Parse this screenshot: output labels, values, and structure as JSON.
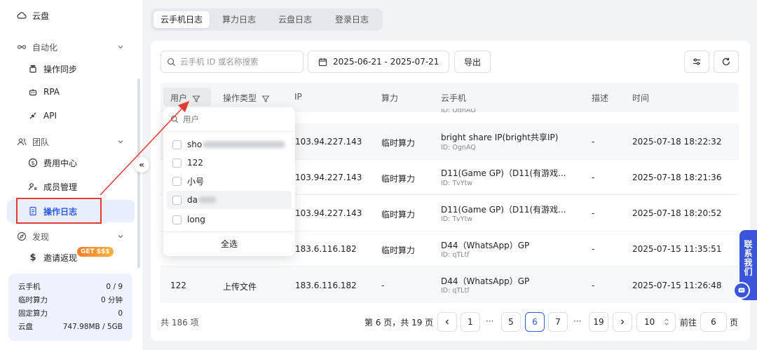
{
  "sidebar": {
    "cloud_disk": "云盘",
    "automation": "自动化",
    "sync": "操作同步",
    "rpa": "RPA",
    "api": "API",
    "team": "团队",
    "billing": "费用中心",
    "members": "成员管理",
    "logs": "操作日志",
    "discover": "发现",
    "invite": "邀请返现",
    "badge": "GET $$$"
  },
  "usage": [
    {
      "label": "云手机",
      "value": "0 / 9"
    },
    {
      "label": "临时算力",
      "value": "0 分钟"
    },
    {
      "label": "固定算力",
      "value": "0"
    },
    {
      "label": "云盘",
      "value": "747.98MB / 5GB"
    }
  ],
  "tabs": [
    "云手机日志",
    "算力日志",
    "云盘日志",
    "登录日志"
  ],
  "toolbar": {
    "search_placeholder": "云手机 ID 或名称搜索",
    "date_range": "2025-06-21 - 2025-07-21",
    "export": "导出"
  },
  "table": {
    "headers": [
      "用户",
      "操作类型",
      "IP",
      "算力",
      "云手机",
      "描述",
      "时间"
    ],
    "partial_id": "ID: OgnAQ",
    "rows": [
      {
        "ip": "103.94.227.143",
        "power": "临时算力",
        "phone": "bright share IP(bright共享IP)",
        "phone_id": "ID: OgnAQ",
        "desc": "-",
        "time": "2025-07-18 18:22:32"
      },
      {
        "ip": "103.94.227.143",
        "power": "临时算力",
        "phone": "D11(Game GP)（D11(有游戏...",
        "phone_id": "ID: TvYtw",
        "desc": "-",
        "time": "2025-07-18 18:21:36"
      },
      {
        "ip": "103.94.227.143",
        "power": "临时算力",
        "phone": "D11(Game GP)（D11(有游戏...",
        "phone_id": "ID: TvYtw",
        "desc": "-",
        "time": "2025-07-18 18:20:52"
      },
      {
        "ip": "183.6.116.182",
        "power": "临时算力",
        "phone": "D44（WhatsApp）GP",
        "phone_id": "ID: qTLtf",
        "desc": "-",
        "time": "2025-07-15 11:35:51"
      },
      {
        "user": "122",
        "op": "上传文件",
        "ip": "183.6.116.182",
        "power": "-",
        "phone": "D44（WhatsApp）GP",
        "phone_id": "ID: qTLtf",
        "desc": "-",
        "time": "2025-07-15 11:26:48"
      }
    ]
  },
  "dropdown": {
    "search_placeholder": "用户",
    "items": [
      "sho",
      "122",
      "小号",
      "da",
      "long"
    ],
    "select_all": "全选"
  },
  "pagination": {
    "total": "共 186 项",
    "page_info": "第 6 页，共 19 页",
    "pages": [
      "1",
      "5",
      "6",
      "7",
      "19"
    ],
    "dots": "···",
    "page_size": "10",
    "goto_label": "前往",
    "goto_value": "6",
    "goto_unit": "页"
  },
  "contact": "联系我们",
  "colors": {
    "accent": "#2f5bea",
    "highlight": "#e53935",
    "contact": "#3a55d9"
  }
}
